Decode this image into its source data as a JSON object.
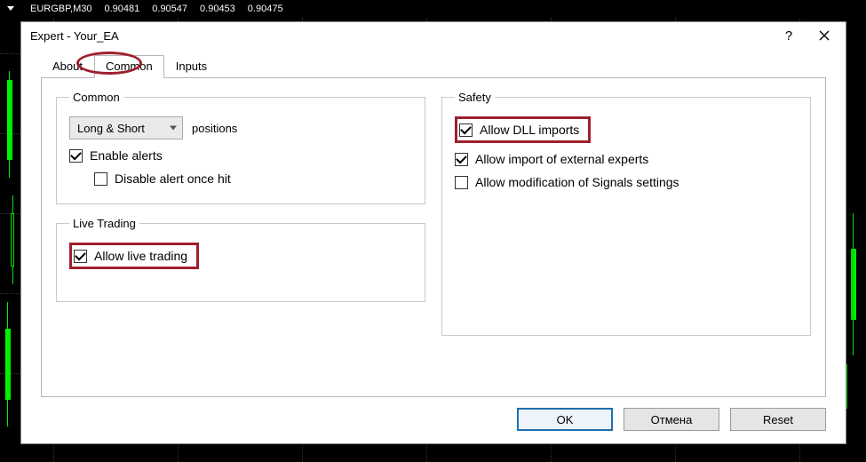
{
  "chart_header": {
    "symbol": "EURGBP,M30",
    "o": "0.90481",
    "h": "0.90547",
    "l": "0.90453",
    "c": "0.90475"
  },
  "dialog": {
    "title": "Expert - Your_EA",
    "help_glyph": "?",
    "tabs": {
      "about": "About",
      "common": "Common",
      "inputs": "Inputs"
    },
    "group_common": {
      "legend": "Common",
      "positions_combo": "Long & Short",
      "positions_suffix": "positions",
      "enable_alerts": "Enable alerts",
      "disable_alert_once": "Disable alert once hit"
    },
    "group_live": {
      "legend": "Live Trading",
      "allow_live": "Allow live trading"
    },
    "group_safety": {
      "legend": "Safety",
      "allow_dll": "Allow DLL imports",
      "allow_ext": "Allow import of external experts",
      "allow_signals": "Allow modification of Signals settings"
    },
    "buttons": {
      "ok": "OK",
      "cancel": "Отмена",
      "reset": "Reset"
    }
  }
}
